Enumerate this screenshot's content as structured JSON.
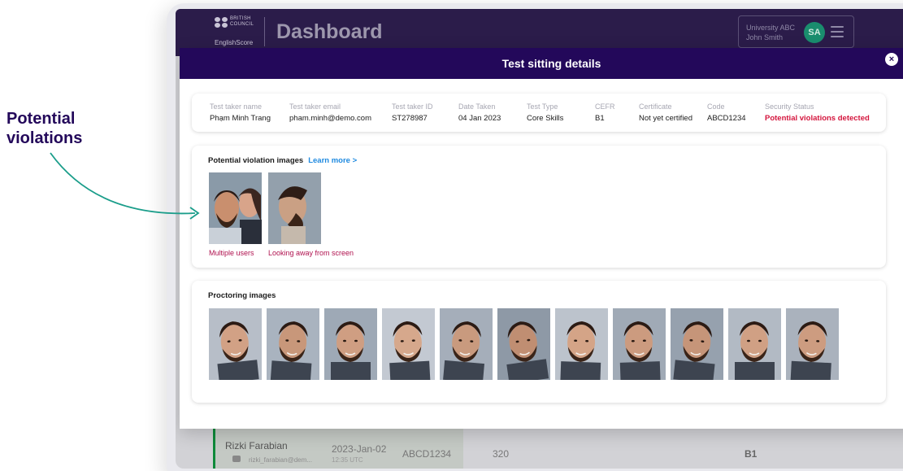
{
  "annotation": {
    "line1": "Potential",
    "line2": "violations"
  },
  "dashboard": {
    "logo_top": "BRITISH",
    "logo_bottom": "COUNCIL",
    "logo_sub": "EnglishScore",
    "title": "Dashboard",
    "user_org": "University ABC",
    "user_name": "John Smith",
    "avatar_initials": "SA",
    "row": {
      "name": "Rizki Farabian",
      "email": "rizki_farabian@dem...",
      "date": "2023-Jan-02",
      "time": "12:35 UTC",
      "code": "ABCD1234",
      "score": "320",
      "cefr": "B1"
    }
  },
  "modal": {
    "title": "Test sitting details",
    "close": "×",
    "info": {
      "columns": [
        {
          "label": "Test taker name",
          "value": "Phạm Minh Trang"
        },
        {
          "label": "Test taker email",
          "value": "pham.minh@demo.com"
        },
        {
          "label": "Test taker ID",
          "value": "ST278987"
        },
        {
          "label": "Date Taken",
          "value": "04 Jan 2023"
        },
        {
          "label": "Test Type",
          "value": "Core Skills"
        },
        {
          "label": "CEFR",
          "value": "B1"
        },
        {
          "label": "Certificate",
          "value": "Not yet certified"
        },
        {
          "label": "Code",
          "value": "ABCD1234"
        },
        {
          "label": "Security Status",
          "value": "Potential violations detected"
        }
      ]
    },
    "violations": {
      "title": "Potential violation images",
      "learn_more": "Learn more >",
      "items": [
        {
          "caption": "Multiple users"
        },
        {
          "caption": "Looking away from screen"
        }
      ]
    },
    "proctoring": {
      "title": "Proctoring images",
      "count": 11
    }
  },
  "colors": {
    "brand": "#23085a",
    "danger": "#d4153d",
    "violation": "#b0124f",
    "link": "#1f8ae0",
    "avatar": "#1a8d6e"
  }
}
